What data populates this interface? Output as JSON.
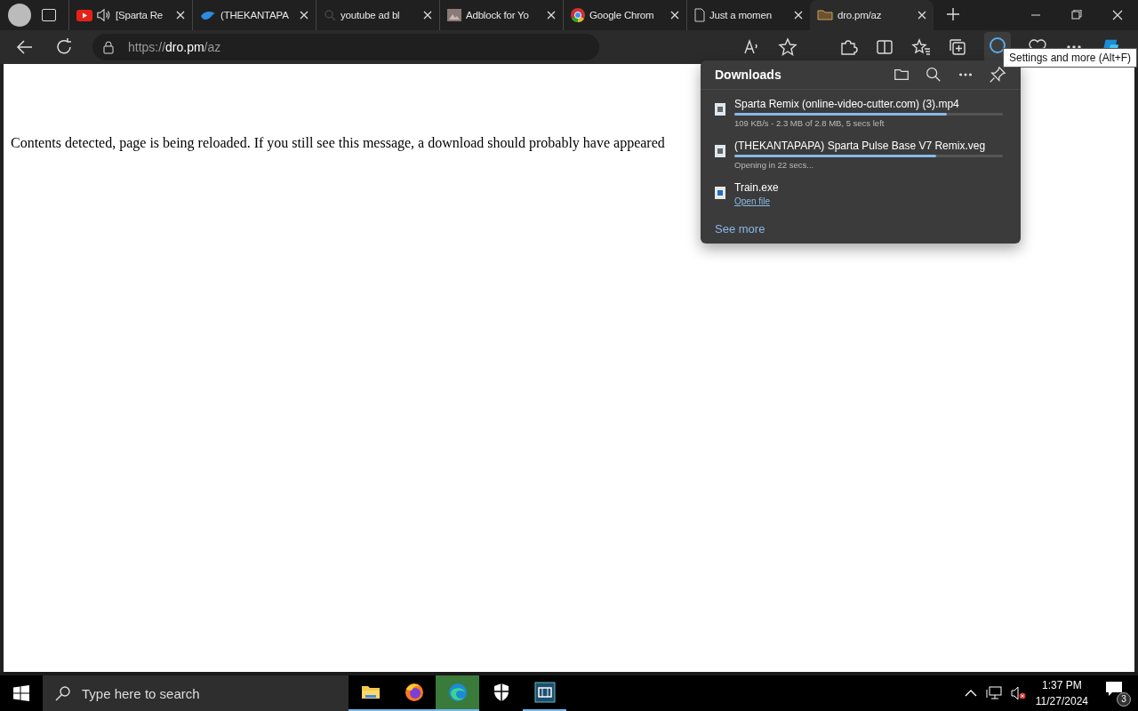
{
  "tabs": [
    {
      "kind": "youtube",
      "label": "[Sparta Re",
      "audio": true,
      "selected": false
    },
    {
      "kind": "bird",
      "label": "(THEKANTAPA",
      "audio": false,
      "selected": false
    },
    {
      "kind": "search",
      "label": "youtube ad bl",
      "audio": false,
      "selected": false
    },
    {
      "kind": "image",
      "label": "Adblock for Yo",
      "audio": false,
      "selected": false
    },
    {
      "kind": "chrome",
      "label": "Google Chrom",
      "audio": false,
      "selected": false
    },
    {
      "kind": "page",
      "label": "Just a momen",
      "audio": false,
      "selected": false
    },
    {
      "kind": "folder",
      "label": "dro.pm/az",
      "audio": false,
      "selected": true
    }
  ],
  "address": {
    "scheme": "https://",
    "host": "dro.pm",
    "path": "/az"
  },
  "page": {
    "message": "Contents detected, page is being reloaded. If you still see this message, a download should probably have appeared"
  },
  "tooltip": "Settings and more (Alt+F)",
  "downloads": {
    "title": "Downloads",
    "items": [
      {
        "kind": "progress",
        "name": "Sparta Remix (online-video-cutter.com) (3).mp4",
        "level": 0.79,
        "status": "109 KB/s - 2.3 MB of 2.8 MB, 5 secs left"
      },
      {
        "kind": "progress",
        "name": "(THEKANTAPAPA) Sparta Pulse Base V7 Remix.veg",
        "level": 0.75,
        "status": "Opening in 22 secs..."
      },
      {
        "kind": "done",
        "name": "Train.exe",
        "link": "Open file"
      }
    ],
    "see_more": "See more"
  },
  "taskbar": {
    "search_placeholder": "Type here to search",
    "apps": [
      {
        "kind": "explorer",
        "open": true,
        "selected": false
      },
      {
        "kind": "firefox",
        "open": true,
        "selected": false
      },
      {
        "kind": "edge",
        "open": true,
        "selected": true
      },
      {
        "kind": "shield",
        "open": false,
        "selected": false
      },
      {
        "kind": "film",
        "open": true,
        "selected": false
      }
    ],
    "time": "1:37 PM",
    "date": "11/27/2024",
    "notifications": "3"
  }
}
